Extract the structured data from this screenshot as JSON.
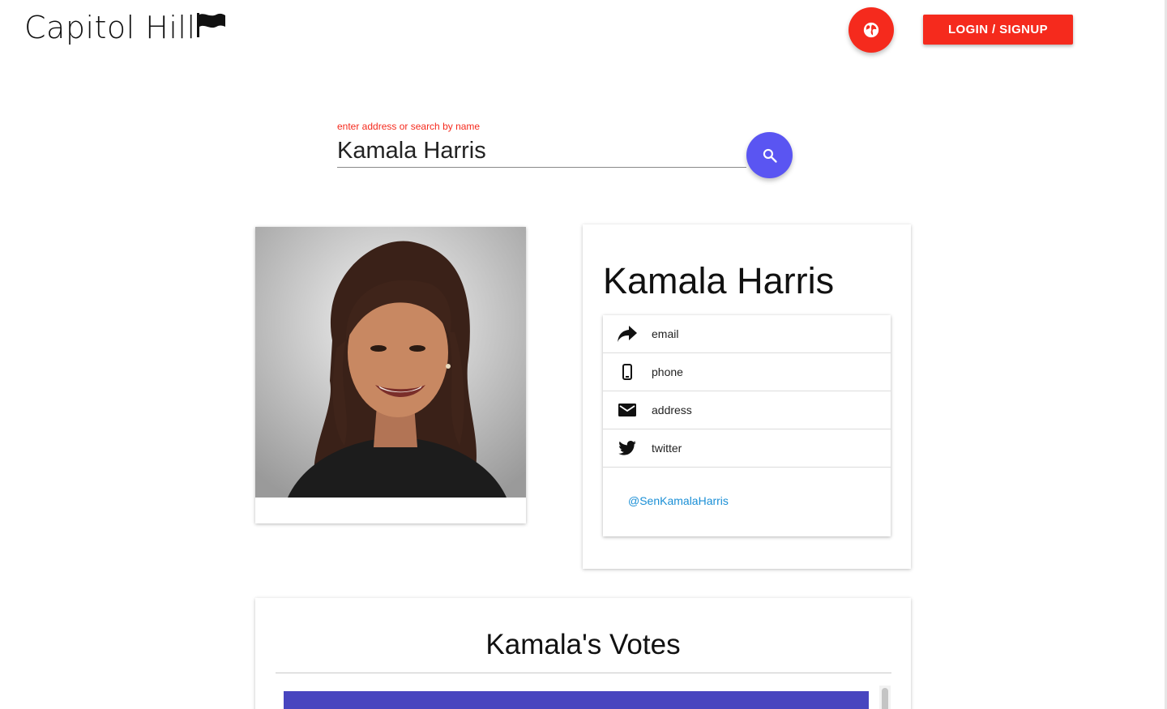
{
  "header": {
    "logo_text": "Capitol Hill",
    "globe_icon": "globe-icon",
    "login_label": "LOGIN / SIGNUP"
  },
  "search": {
    "label": "enter address or search by name",
    "value": "Kamala Harris",
    "button_icon": "search-icon"
  },
  "profile": {
    "photo_alt": "Kamala Harris",
    "name": "Kamala Harris",
    "contacts": [
      {
        "icon": "share-arrow-icon",
        "label": "email"
      },
      {
        "icon": "mobile-phone-icon",
        "label": "phone"
      },
      {
        "icon": "envelope-icon",
        "label": "address"
      },
      {
        "icon": "twitter-bird-icon",
        "label": "twitter"
      }
    ],
    "twitter_handle": "@SenKamalaHarris"
  },
  "votes": {
    "title": "Kamala's Votes"
  },
  "colors": {
    "accent_red": "#f52a1d",
    "search_blue": "#5a55f2",
    "votes_bar": "#4845bf",
    "link_blue": "#1a8fd6"
  }
}
